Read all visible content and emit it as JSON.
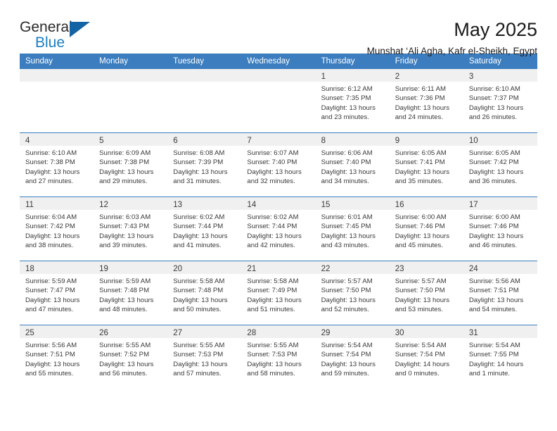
{
  "brand": {
    "word1": "General",
    "word2": "Blue",
    "accent_color": "#1b7ec2",
    "triangle_color": "#1464a5"
  },
  "header": {
    "title": "May 2025",
    "location": "Munshat ‘Ali Agha, Kafr el-Sheikh, Egypt"
  },
  "calendar": {
    "header_bg": "#3b7dbf",
    "daynum_band_bg": "#f0f0f0",
    "weekday_headers": [
      "Sunday",
      "Monday",
      "Tuesday",
      "Wednesday",
      "Thursday",
      "Friday",
      "Saturday"
    ],
    "weeks": [
      [
        {
          "day": "",
          "sunrise": "",
          "sunset": "",
          "daylight1": "",
          "daylight2": ""
        },
        {
          "day": "",
          "sunrise": "",
          "sunset": "",
          "daylight1": "",
          "daylight2": ""
        },
        {
          "day": "",
          "sunrise": "",
          "sunset": "",
          "daylight1": "",
          "daylight2": ""
        },
        {
          "day": "",
          "sunrise": "",
          "sunset": "",
          "daylight1": "",
          "daylight2": ""
        },
        {
          "day": "1",
          "sunrise": "Sunrise: 6:12 AM",
          "sunset": "Sunset: 7:35 PM",
          "daylight1": "Daylight: 13 hours",
          "daylight2": "and 23 minutes."
        },
        {
          "day": "2",
          "sunrise": "Sunrise: 6:11 AM",
          "sunset": "Sunset: 7:36 PM",
          "daylight1": "Daylight: 13 hours",
          "daylight2": "and 24 minutes."
        },
        {
          "day": "3",
          "sunrise": "Sunrise: 6:10 AM",
          "sunset": "Sunset: 7:37 PM",
          "daylight1": "Daylight: 13 hours",
          "daylight2": "and 26 minutes."
        }
      ],
      [
        {
          "day": "4",
          "sunrise": "Sunrise: 6:10 AM",
          "sunset": "Sunset: 7:38 PM",
          "daylight1": "Daylight: 13 hours",
          "daylight2": "and 27 minutes."
        },
        {
          "day": "5",
          "sunrise": "Sunrise: 6:09 AM",
          "sunset": "Sunset: 7:38 PM",
          "daylight1": "Daylight: 13 hours",
          "daylight2": "and 29 minutes."
        },
        {
          "day": "6",
          "sunrise": "Sunrise: 6:08 AM",
          "sunset": "Sunset: 7:39 PM",
          "daylight1": "Daylight: 13 hours",
          "daylight2": "and 31 minutes."
        },
        {
          "day": "7",
          "sunrise": "Sunrise: 6:07 AM",
          "sunset": "Sunset: 7:40 PM",
          "daylight1": "Daylight: 13 hours",
          "daylight2": "and 32 minutes."
        },
        {
          "day": "8",
          "sunrise": "Sunrise: 6:06 AM",
          "sunset": "Sunset: 7:40 PM",
          "daylight1": "Daylight: 13 hours",
          "daylight2": "and 34 minutes."
        },
        {
          "day": "9",
          "sunrise": "Sunrise: 6:05 AM",
          "sunset": "Sunset: 7:41 PM",
          "daylight1": "Daylight: 13 hours",
          "daylight2": "and 35 minutes."
        },
        {
          "day": "10",
          "sunrise": "Sunrise: 6:05 AM",
          "sunset": "Sunset: 7:42 PM",
          "daylight1": "Daylight: 13 hours",
          "daylight2": "and 36 minutes."
        }
      ],
      [
        {
          "day": "11",
          "sunrise": "Sunrise: 6:04 AM",
          "sunset": "Sunset: 7:42 PM",
          "daylight1": "Daylight: 13 hours",
          "daylight2": "and 38 minutes."
        },
        {
          "day": "12",
          "sunrise": "Sunrise: 6:03 AM",
          "sunset": "Sunset: 7:43 PM",
          "daylight1": "Daylight: 13 hours",
          "daylight2": "and 39 minutes."
        },
        {
          "day": "13",
          "sunrise": "Sunrise: 6:02 AM",
          "sunset": "Sunset: 7:44 PM",
          "daylight1": "Daylight: 13 hours",
          "daylight2": "and 41 minutes."
        },
        {
          "day": "14",
          "sunrise": "Sunrise: 6:02 AM",
          "sunset": "Sunset: 7:44 PM",
          "daylight1": "Daylight: 13 hours",
          "daylight2": "and 42 minutes."
        },
        {
          "day": "15",
          "sunrise": "Sunrise: 6:01 AM",
          "sunset": "Sunset: 7:45 PM",
          "daylight1": "Daylight: 13 hours",
          "daylight2": "and 43 minutes."
        },
        {
          "day": "16",
          "sunrise": "Sunrise: 6:00 AM",
          "sunset": "Sunset: 7:46 PM",
          "daylight1": "Daylight: 13 hours",
          "daylight2": "and 45 minutes."
        },
        {
          "day": "17",
          "sunrise": "Sunrise: 6:00 AM",
          "sunset": "Sunset: 7:46 PM",
          "daylight1": "Daylight: 13 hours",
          "daylight2": "and 46 minutes."
        }
      ],
      [
        {
          "day": "18",
          "sunrise": "Sunrise: 5:59 AM",
          "sunset": "Sunset: 7:47 PM",
          "daylight1": "Daylight: 13 hours",
          "daylight2": "and 47 minutes."
        },
        {
          "day": "19",
          "sunrise": "Sunrise: 5:59 AM",
          "sunset": "Sunset: 7:48 PM",
          "daylight1": "Daylight: 13 hours",
          "daylight2": "and 48 minutes."
        },
        {
          "day": "20",
          "sunrise": "Sunrise: 5:58 AM",
          "sunset": "Sunset: 7:48 PM",
          "daylight1": "Daylight: 13 hours",
          "daylight2": "and 50 minutes."
        },
        {
          "day": "21",
          "sunrise": "Sunrise: 5:58 AM",
          "sunset": "Sunset: 7:49 PM",
          "daylight1": "Daylight: 13 hours",
          "daylight2": "and 51 minutes."
        },
        {
          "day": "22",
          "sunrise": "Sunrise: 5:57 AM",
          "sunset": "Sunset: 7:50 PM",
          "daylight1": "Daylight: 13 hours",
          "daylight2": "and 52 minutes."
        },
        {
          "day": "23",
          "sunrise": "Sunrise: 5:57 AM",
          "sunset": "Sunset: 7:50 PM",
          "daylight1": "Daylight: 13 hours",
          "daylight2": "and 53 minutes."
        },
        {
          "day": "24",
          "sunrise": "Sunrise: 5:56 AM",
          "sunset": "Sunset: 7:51 PM",
          "daylight1": "Daylight: 13 hours",
          "daylight2": "and 54 minutes."
        }
      ],
      [
        {
          "day": "25",
          "sunrise": "Sunrise: 5:56 AM",
          "sunset": "Sunset: 7:51 PM",
          "daylight1": "Daylight: 13 hours",
          "daylight2": "and 55 minutes."
        },
        {
          "day": "26",
          "sunrise": "Sunrise: 5:55 AM",
          "sunset": "Sunset: 7:52 PM",
          "daylight1": "Daylight: 13 hours",
          "daylight2": "and 56 minutes."
        },
        {
          "day": "27",
          "sunrise": "Sunrise: 5:55 AM",
          "sunset": "Sunset: 7:53 PM",
          "daylight1": "Daylight: 13 hours",
          "daylight2": "and 57 minutes."
        },
        {
          "day": "28",
          "sunrise": "Sunrise: 5:55 AM",
          "sunset": "Sunset: 7:53 PM",
          "daylight1": "Daylight: 13 hours",
          "daylight2": "and 58 minutes."
        },
        {
          "day": "29",
          "sunrise": "Sunrise: 5:54 AM",
          "sunset": "Sunset: 7:54 PM",
          "daylight1": "Daylight: 13 hours",
          "daylight2": "and 59 minutes."
        },
        {
          "day": "30",
          "sunrise": "Sunrise: 5:54 AM",
          "sunset": "Sunset: 7:54 PM",
          "daylight1": "Daylight: 14 hours",
          "daylight2": "and 0 minutes."
        },
        {
          "day": "31",
          "sunrise": "Sunrise: 5:54 AM",
          "sunset": "Sunset: 7:55 PM",
          "daylight1": "Daylight: 14 hours",
          "daylight2": "and 1 minute."
        }
      ]
    ]
  }
}
